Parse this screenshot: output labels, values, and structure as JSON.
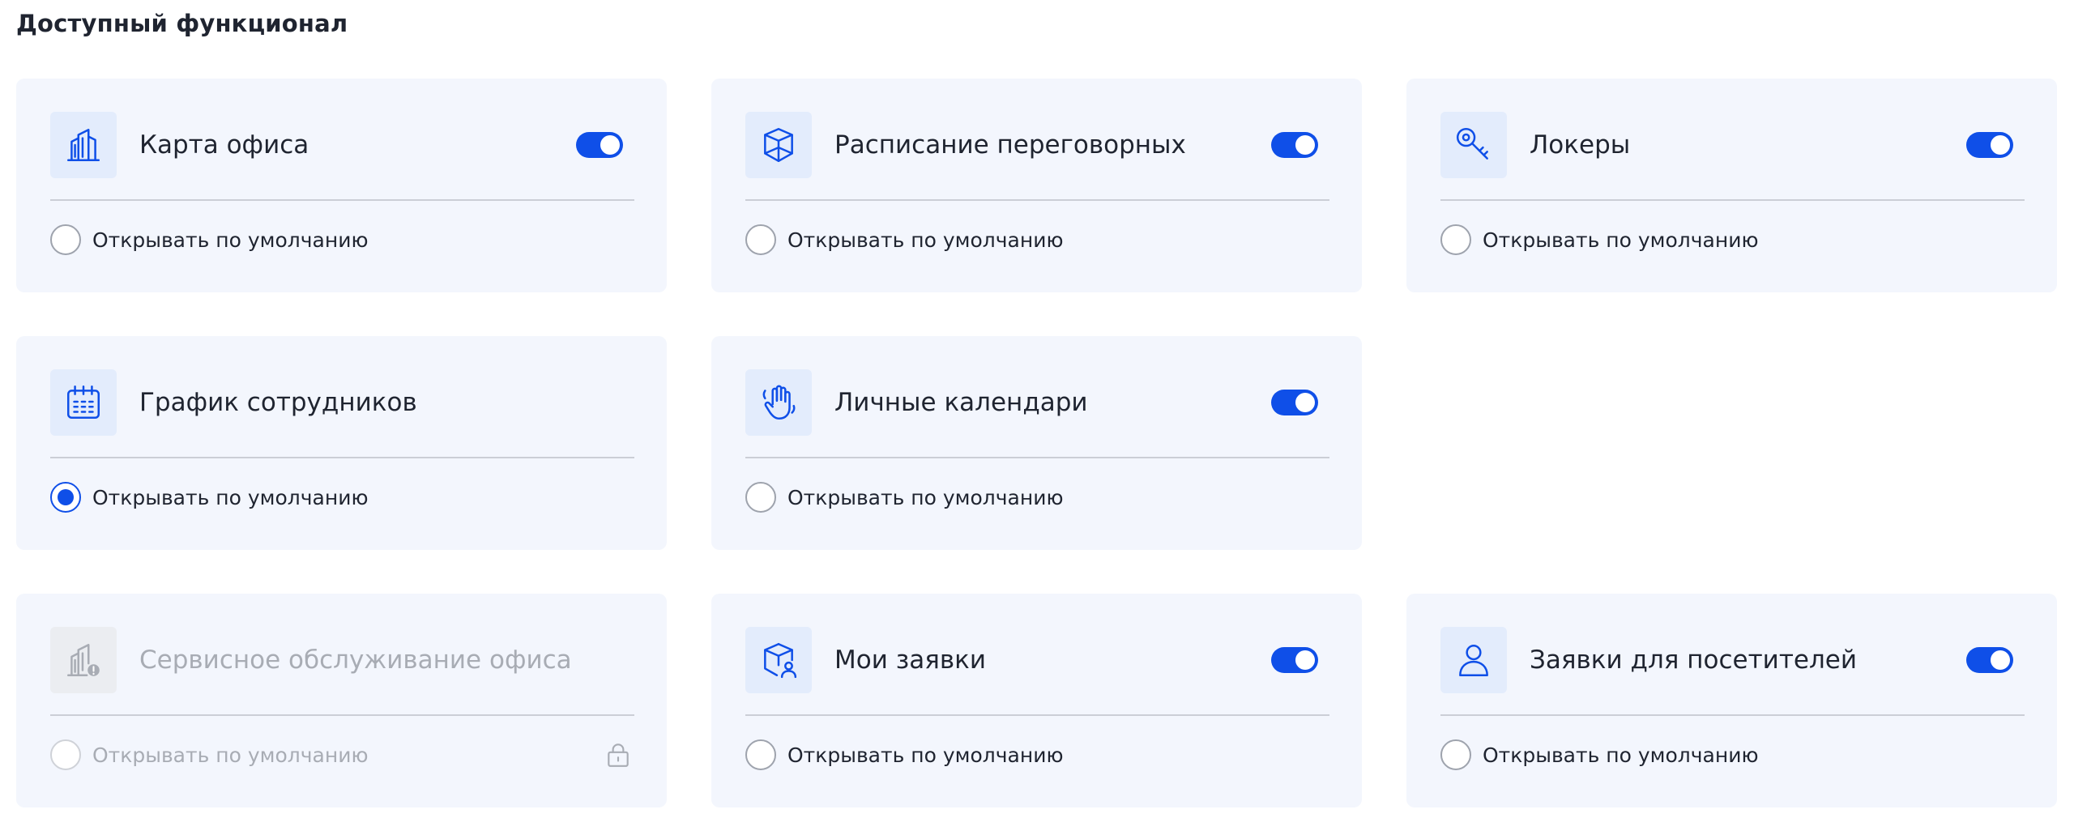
{
  "page": {
    "title": "Доступный функционал"
  },
  "colors": {
    "accent": "#0f4fe8",
    "card_bg": "#f3f6fd",
    "icon_bg": "#e3ecfc",
    "disabled_text": "#a8acb4"
  },
  "cards": [
    {
      "title": "Карта офиса",
      "icon": "office-buildings-icon",
      "toggle_on": true,
      "default_label": "Открывать по умолчанию",
      "default_selected": false,
      "disabled": false
    },
    {
      "title": "Расписание переговорных",
      "icon": "meeting-room-cube-icon",
      "toggle_on": true,
      "default_label": "Открывать по умолчанию",
      "default_selected": false,
      "disabled": false
    },
    {
      "title": "Локеры",
      "icon": "key-icon",
      "toggle_on": true,
      "default_label": "Открывать по умолчанию",
      "default_selected": false,
      "disabled": false
    },
    {
      "title": "График сотрудников",
      "icon": "calendar-schedule-icon",
      "toggle_on": false,
      "default_label": "Открывать по умолчанию",
      "default_selected": true,
      "disabled": false
    },
    {
      "title": "Личные календари",
      "icon": "waving-hand-icon",
      "toggle_on": true,
      "default_label": "Открывать по умолчанию",
      "default_selected": false,
      "disabled": false
    },
    {
      "title": "Сервисное обслуживание офиса",
      "icon": "office-service-icon",
      "toggle_on": false,
      "default_label": "Открывать по умолчанию",
      "default_selected": false,
      "disabled": true,
      "locked": true
    },
    {
      "title": "Мои заявки",
      "icon": "cube-user-icon",
      "toggle_on": true,
      "default_label": "Открывать по умолчанию",
      "default_selected": false,
      "disabled": false
    },
    {
      "title": "Заявки для посетителей",
      "icon": "visitor-person-icon",
      "toggle_on": true,
      "default_label": "Открывать по умолчанию",
      "default_selected": false,
      "disabled": false
    }
  ]
}
